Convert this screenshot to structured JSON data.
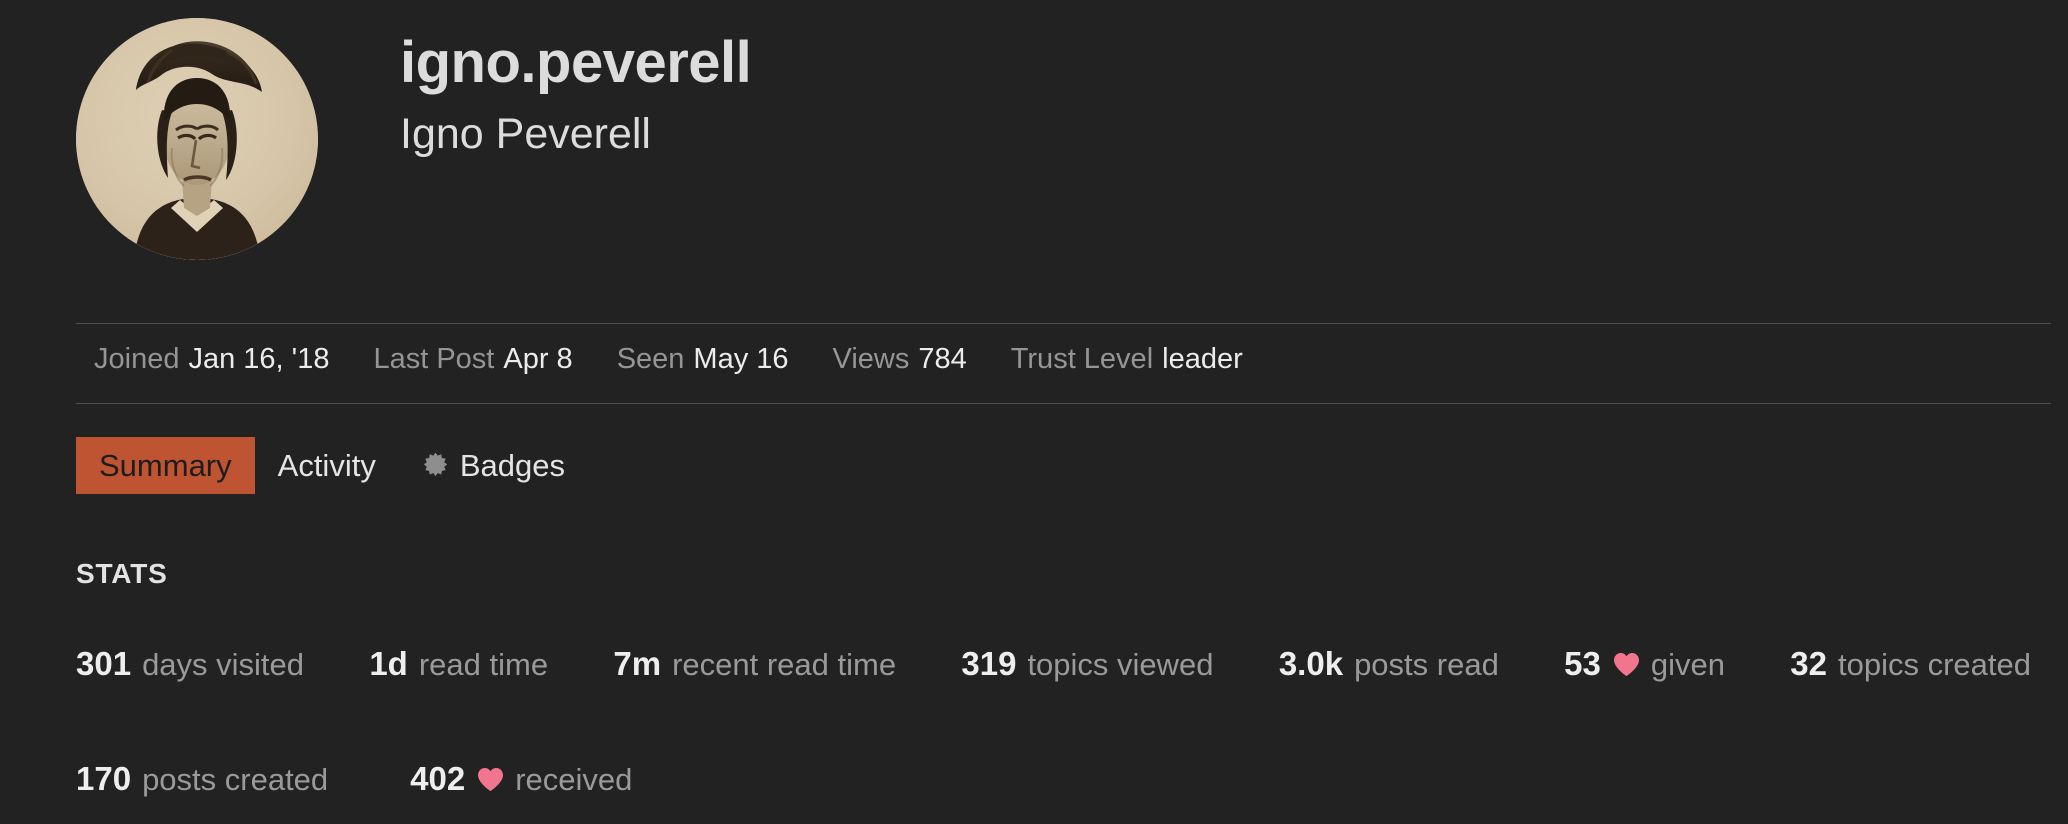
{
  "theme": {
    "background": "#222222",
    "text_primary": "#dcdcdc",
    "text_muted": "#9a9a9a",
    "accent": "#bf5433",
    "heart": "#f2758f",
    "divider": "#4c4c4c"
  },
  "profile": {
    "username": "igno.peverell",
    "full_name": "Igno Peverell",
    "avatar_alt": "avatar-portrait-sketch"
  },
  "metadata": [
    {
      "label": "Joined",
      "value": "Jan 16, '18"
    },
    {
      "label": "Last Post",
      "value": "Apr 8"
    },
    {
      "label": "Seen",
      "value": "May 16"
    },
    {
      "label": "Views",
      "value": "784"
    },
    {
      "label": "Trust Level",
      "value": "leader"
    }
  ],
  "tabs": [
    {
      "label": "Summary",
      "active": true,
      "icon": null
    },
    {
      "label": "Activity",
      "active": false,
      "icon": null
    },
    {
      "label": "Badges",
      "active": false,
      "icon": "badge-starburst-icon"
    }
  ],
  "stats": {
    "heading": "STATS",
    "row1": [
      {
        "value": "301",
        "label": "days visited",
        "icon": null
      },
      {
        "value": "1d",
        "label": "read time",
        "icon": null
      },
      {
        "value": "7m",
        "label": "recent read time",
        "icon": null
      },
      {
        "value": "319",
        "label": "topics viewed",
        "icon": null
      },
      {
        "value": "3.0k",
        "label": "posts read",
        "icon": null
      },
      {
        "value": "53",
        "label": "given",
        "icon": "heart-icon"
      },
      {
        "value": "32",
        "label": "topics created",
        "icon": null
      }
    ],
    "row2": [
      {
        "value": "170",
        "label": "posts created",
        "icon": null
      },
      {
        "value": "402",
        "label": "received",
        "icon": "heart-icon"
      }
    ]
  }
}
